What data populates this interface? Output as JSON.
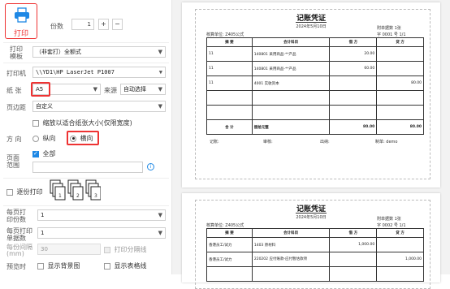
{
  "print_panel": {
    "print_button_label": "打印",
    "copies": {
      "label": "份数",
      "value": "1",
      "plus": "+",
      "minus": "−"
    },
    "template": {
      "label_line1": "打印",
      "label_line2": "模板",
      "value": "（非套打）全额式"
    },
    "printer": {
      "label": "打印机",
      "value": "\\\\YD1\\HP LaserJet P1007"
    },
    "paper": {
      "label": "纸  张",
      "value": "A5",
      "source_label": "来源",
      "source_value": "自动选择"
    },
    "margin": {
      "label": "页边距",
      "value": "自定义"
    },
    "shrink": {
      "label": "缩放以适合纸张大小(仅限宽度)",
      "checked": false
    },
    "orientation": {
      "label": "方  向",
      "portrait": "纵向",
      "landscape": "横向",
      "selected": "landscape"
    },
    "range": {
      "label_line1": "页面",
      "label_line2": "范围",
      "all_label": "全部",
      "all_checked": true,
      "input_value": ""
    },
    "collate": {
      "label": "逐份打印",
      "checked": false,
      "icon_pages": [
        "1",
        "2",
        "3"
      ]
    },
    "per_page_rows": {
      "label_line1": "每页打",
      "label_line2": "印份数",
      "value": "1"
    },
    "per_page_docs": {
      "label_line1": "每页打印",
      "label_line2": "单据数",
      "value": "1"
    },
    "spacing": {
      "label_line1": "每份间隔",
      "label_line2": "(mm)",
      "value": "30",
      "separator_label": "打印分隔线"
    },
    "preview_opts": {
      "label": "预览时",
      "bg_label": "显示背景图",
      "grid_label": "显示表格线"
    }
  },
  "vouchers": [
    {
      "title": "记账凭证",
      "date": "2024年5月10日",
      "left_info": "核算单位: Z405公式",
      "right_info_1": "附单据数         1张",
      "right_info_2": "字   0001  号     1/1",
      "headers": [
        "摘  要",
        "会计科目",
        "借  方",
        "贷  方"
      ],
      "rows": [
        {
          "summary": "11",
          "account": "140801 采用商品-**产品",
          "debit": "20.00",
          "credit": ""
        },
        {
          "summary": "11",
          "account": "140801 采用商品-**产品",
          "debit": "60.00",
          "credit": ""
        },
        {
          "summary": "11",
          "account": "4001 实收资本",
          "debit": "",
          "credit": "80.00"
        },
        {
          "summary": "",
          "account": "",
          "debit": "",
          "credit": ""
        },
        {
          "summary": "",
          "account": "",
          "debit": "",
          "credit": ""
        }
      ],
      "total_label": "合  计",
      "total_text": "捌拾元整",
      "total_debit": "80.00",
      "total_credit": "80.00",
      "footer": [
        "记账:",
        "审核:",
        "出纳:",
        "制单: demo"
      ]
    },
    {
      "title": "记账凭证",
      "date": "2024年5月10日",
      "left_info": "核算单位: Z405公式",
      "right_info_1": "附单据数         1张",
      "right_info_2": "字   0002  号     1/1",
      "headers": [
        "摘  要",
        "会计科目",
        "借  方",
        "贷  方"
      ],
      "rows": [
        {
          "summary": "香港员工/试力",
          "account": "1403 原材料",
          "debit": "1,000.00",
          "credit": ""
        },
        {
          "summary": "香港员工/试力",
          "account": "220202 应付账款-应付暂估款项",
          "debit": "",
          "credit": "1,000.00"
        },
        {
          "summary": "",
          "account": "",
          "debit": "",
          "credit": ""
        }
      ]
    }
  ],
  "colors": {
    "accent": "#1e88e5",
    "highlight": "#e33333"
  }
}
